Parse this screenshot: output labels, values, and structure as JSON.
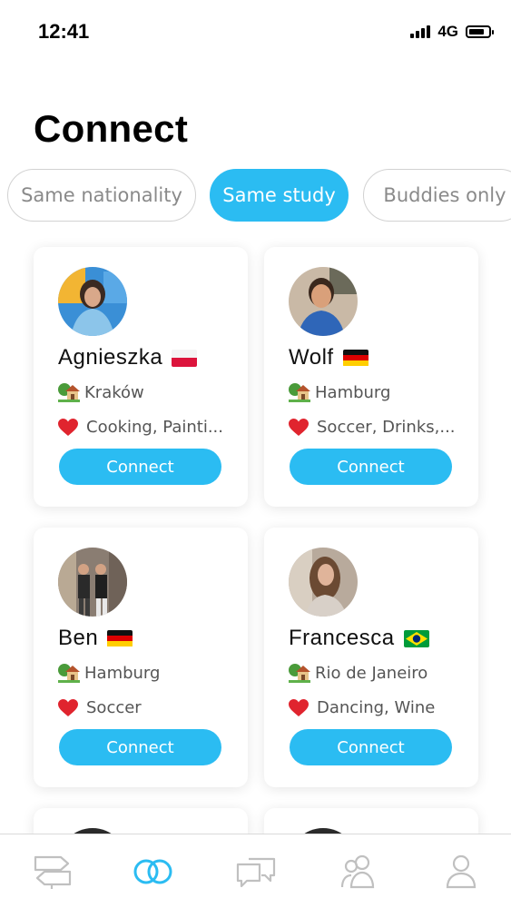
{
  "status_bar": {
    "time": "12:41",
    "network": "4G"
  },
  "page": {
    "title": "Connect"
  },
  "filters": [
    {
      "label": "Same nationality",
      "active": false
    },
    {
      "label": "Same study",
      "active": true
    },
    {
      "label": "Buddies only",
      "active": false
    }
  ],
  "cards": [
    {
      "name": "Agnieszka",
      "flag": "poland",
      "city": "Kraków",
      "interests": "Cooking,  Painti...",
      "button": "Connect"
    },
    {
      "name": "Wolf",
      "flag": "germany",
      "city": "Hamburg",
      "interests": "Soccer,  Drinks,...",
      "button": "Connect"
    },
    {
      "name": "Ben",
      "flag": "germany",
      "city": "Hamburg",
      "interests": "Soccer",
      "button": "Connect"
    },
    {
      "name": "Francesca",
      "flag": "brazil",
      "city": "Rio de Janeiro",
      "interests": "Dancing,  Wine",
      "button": "Connect"
    }
  ],
  "icons": {
    "city": "house-with-garden-icon",
    "interests": "red-heart-icon"
  },
  "tab_bar": [
    {
      "icon": "signpost-icon",
      "active": false
    },
    {
      "icon": "connect-rings-icon",
      "active": true
    },
    {
      "icon": "chat-bubbles-icon",
      "active": false
    },
    {
      "icon": "people-icon",
      "active": false
    },
    {
      "icon": "profile-icon",
      "active": false
    }
  ],
  "colors": {
    "accent": "#2bbcf2",
    "inactive_icon": "#c0c0c0",
    "chip_text": "#8a8a8a"
  }
}
